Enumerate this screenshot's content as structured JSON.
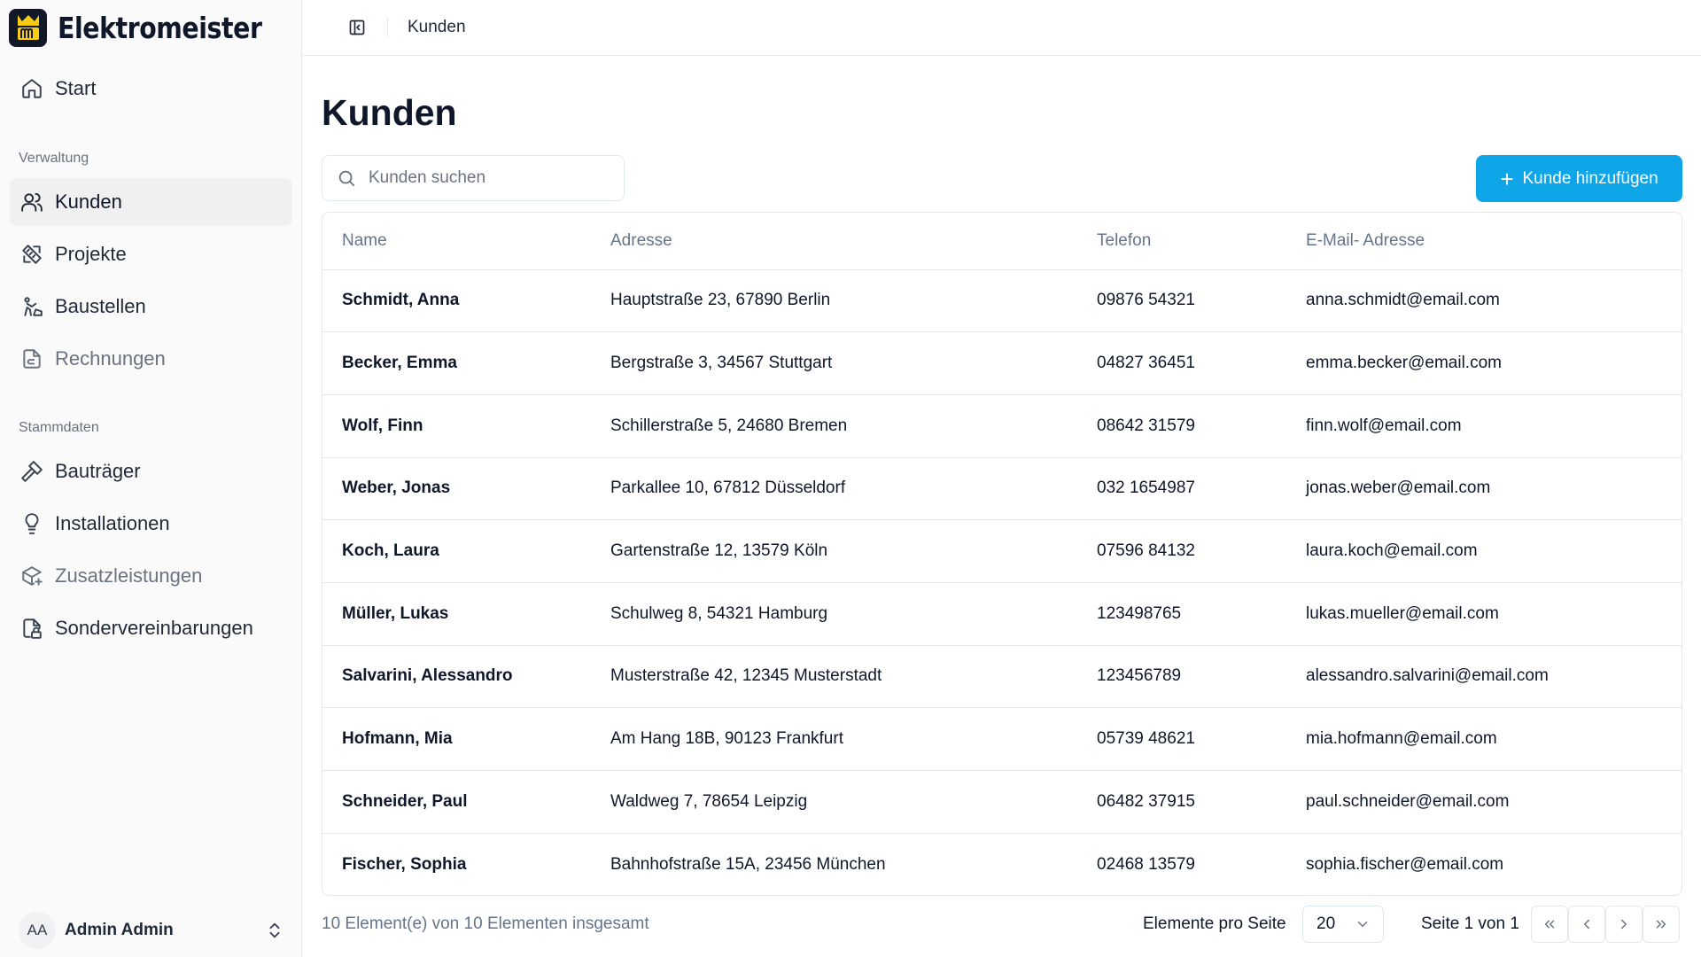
{
  "brand": {
    "name": "Elektromeister",
    "logo_letter": "m"
  },
  "sidebar": {
    "start": "Start",
    "section_verwaltung": "Verwaltung",
    "items_verwaltung": [
      {
        "label": "Kunden"
      },
      {
        "label": "Projekte"
      },
      {
        "label": "Baustellen"
      },
      {
        "label": "Rechnungen"
      }
    ],
    "section_stammdaten": "Stammdaten",
    "items_stammdaten": [
      {
        "label": "Bauträger"
      },
      {
        "label": "Installationen"
      },
      {
        "label": "Zusatzleistungen"
      },
      {
        "label": "Sondervereinbarungen"
      }
    ],
    "user": {
      "initials": "AA",
      "name": "Admin Admin"
    }
  },
  "topbar": {
    "breadcrumb": "Kunden"
  },
  "page": {
    "title": "Kunden",
    "search_placeholder": "Kunden suchen",
    "add_button": "Kunde hinzufügen"
  },
  "table": {
    "headers": [
      "Name",
      "Adresse",
      "Telefon",
      "E-Mail- Adresse"
    ],
    "rows": [
      [
        "Schmidt, Anna",
        "Hauptstraße 23, 67890 Berlin",
        "09876 54321",
        "anna.schmidt@email.com"
      ],
      [
        "Becker, Emma",
        "Bergstraße 3, 34567 Stuttgart",
        "04827 36451",
        "emma.becker@email.com"
      ],
      [
        "Wolf, Finn",
        "Schillerstraße 5, 24680 Bremen",
        "08642 31579",
        "finn.wolf@email.com"
      ],
      [
        "Weber, Jonas",
        "Parkallee 10, 67812 Düsseldorf",
        "032 1654987",
        "jonas.weber@email.com"
      ],
      [
        "Koch, Laura",
        "Gartenstraße 12, 13579 Köln",
        "07596 84132",
        "laura.koch@email.com"
      ],
      [
        "Müller, Lukas",
        "Schulweg 8, 54321 Hamburg",
        "123498765",
        "lukas.mueller@email.com"
      ],
      [
        "Salvarini, Alessandro",
        "Musterstraße 42, 12345 Musterstadt",
        "123456789",
        "alessandro.salvarini@email.com"
      ],
      [
        "Hofmann, Mia",
        "Am Hang 18B, 90123 Frankfurt",
        "05739 48621",
        "mia.hofmann@email.com"
      ],
      [
        "Schneider, Paul",
        "Waldweg 7, 78654 Leipzig",
        "06482 37915",
        "paul.schneider@email.com"
      ],
      [
        "Fischer, Sophia",
        "Bahnhofstraße 15A, 23456 München",
        "02468 13579",
        "sophia.fischer@email.com"
      ]
    ]
  },
  "footer": {
    "count_text": "10 Element(e) von 10 Elementen insgesamt",
    "per_page_label": "Elemente pro Seite",
    "per_page_value": "20",
    "page_info": "Seite 1 von 1"
  },
  "colors": {
    "accent": "#0ea5e9",
    "brand_bg": "#111827",
    "brand_yellow": "#facc15"
  }
}
